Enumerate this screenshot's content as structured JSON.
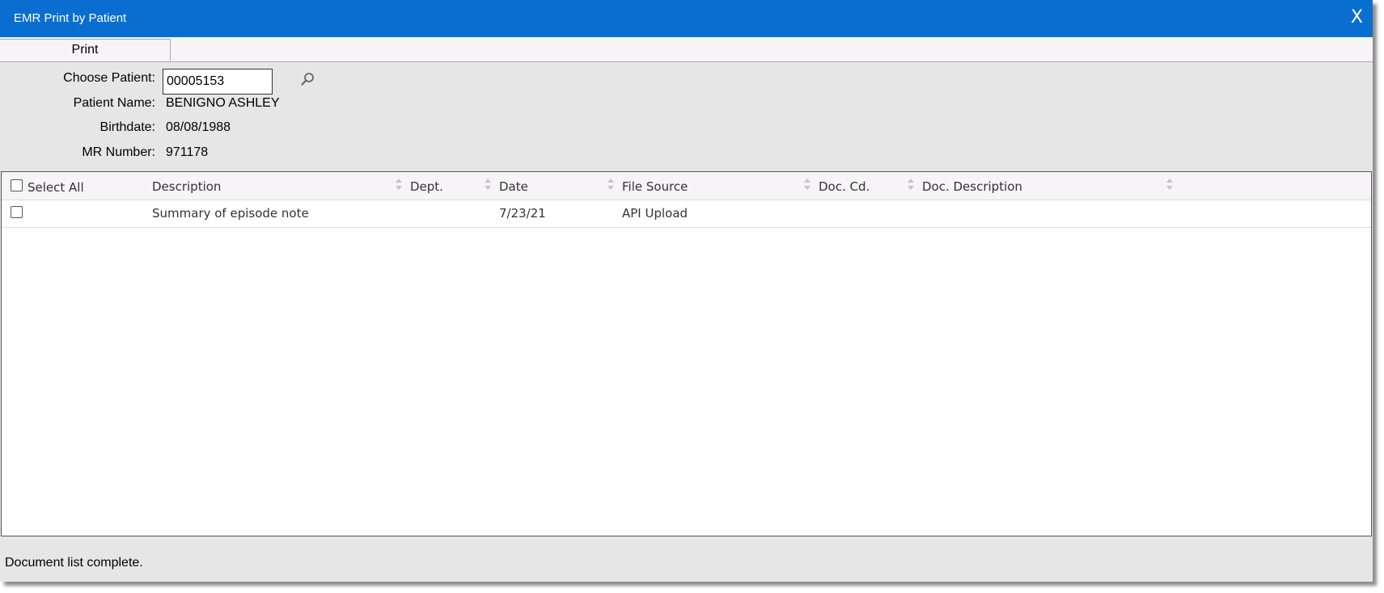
{
  "window": {
    "title": "EMR Print by Patient",
    "close_label": "X"
  },
  "tabs": {
    "print_label": "Print"
  },
  "form": {
    "choose_patient_label": "Choose Patient:",
    "patient_id_value": "00005153",
    "patient_name_label": "Patient Name:",
    "patient_name_value": "BENIGNO ASHLEY",
    "birthdate_label": "Birthdate:",
    "birthdate_value": "08/08/1988",
    "mr_number_label": "MR Number:",
    "mr_number_value": "971178"
  },
  "grid": {
    "columns": {
      "select_all": "Select All",
      "description": "Description",
      "dept": "Dept.",
      "date": "Date",
      "file_source": "File Source",
      "doc_cd": "Doc. Cd.",
      "doc_description": "Doc. Description"
    },
    "rows": [
      {
        "checked": false,
        "description": "Summary of episode note",
        "dept": "",
        "date": "7/23/21",
        "file_source": "API Upload",
        "doc_cd": "",
        "doc_description": ""
      }
    ]
  },
  "status": {
    "message": "Document list complete."
  },
  "icons": {
    "search": "search-icon",
    "sort": "sort-icon",
    "close": "close-icon"
  },
  "colors": {
    "titlebar": "#0a6ed1",
    "panel": "#e6e6e6",
    "header": "#f6f4f6"
  }
}
